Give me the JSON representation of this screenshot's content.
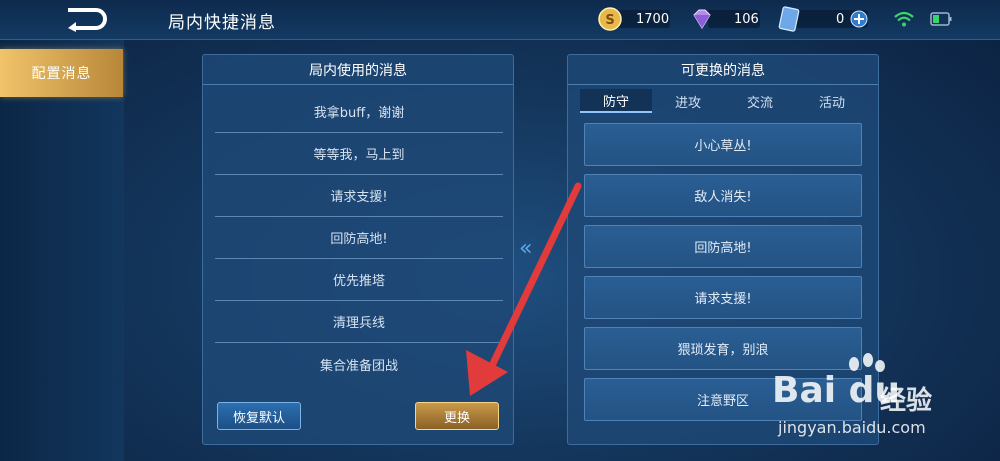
{
  "header": {
    "title": "局内快捷消息",
    "coins": "1700",
    "diamonds": "106",
    "cards": "0"
  },
  "sidebar": {
    "item_label": "配置消息"
  },
  "left_panel": {
    "title": "局内使用的消息",
    "messages": [
      "我拿buff，谢谢",
      "等等我，马上到",
      "请求支援!",
      "回防高地!",
      "优先推塔",
      "清理兵线",
      "集合准备团战"
    ],
    "reset_label": "恢复默认",
    "swap_label": "更换"
  },
  "right_panel": {
    "title": "可更换的消息",
    "tabs": [
      "防守",
      "进攻",
      "交流",
      "活动"
    ],
    "options": [
      "小心草丛!",
      "敌人消失!",
      "回防高地!",
      "请求支援!",
      "猥琐发育，别浪",
      "注意野区"
    ]
  },
  "watermark": {
    "brand": "Bai du",
    "cn": "经验",
    "url": "jingyan.baidu.com"
  },
  "colors": {
    "accent": "#f0c46a",
    "arrow": "#e23b3b",
    "tab_active": "#8fc6ff"
  }
}
